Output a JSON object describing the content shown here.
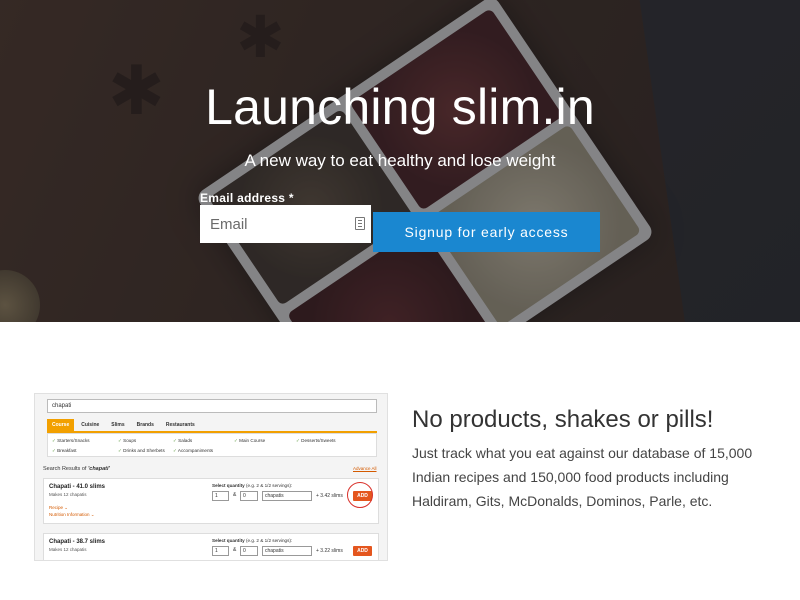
{
  "hero": {
    "title": "Launching slim.in",
    "subtitle": "A new way to eat healthy and lose weight",
    "email_label": "Email address *",
    "email_placeholder": "Email",
    "signup_label": "Signup for early access"
  },
  "feature": {
    "title": "No products, shakes or pills!",
    "body": "Just track what you eat against our database of 15,000 Indian recipes and 150,000 food products including Haldiram, Gits, McDonalds, Dominos, Parle, etc."
  },
  "preview": {
    "search_value": "chapati",
    "tabs": [
      "Course",
      "Cuisine",
      "Slims",
      "Brands",
      "Restaurants"
    ],
    "filters": [
      "Starters/Snacks",
      "Soups",
      "Salads",
      "Main Course",
      "Desserts/Sweets",
      "Breakfast",
      "Drinks and Sherbets",
      "Accompaniments"
    ],
    "results_prefix": "Search Results of",
    "results_query": "'chapati'",
    "right_link": "Advance All",
    "items": [
      {
        "name": "Chapati - 41.0 slims",
        "sub": "Makes 12 chapatis",
        "recipe": "Recipe ⌄",
        "nutrition": "Nutrition Information ⌄",
        "qty_label_bold": "Select quantity",
        "qty_label_rest": "(e.g. 2 & 1/2 servings):",
        "qty": "1",
        "amp": "&",
        "frac": "0",
        "unit": "chapatis",
        "slims": "+ 3.42 slims",
        "add": "ADD"
      },
      {
        "name": "Chapati - 38.7 slims",
        "sub": "Makes 12 chapatis",
        "qty_label_bold": "Select quantity",
        "qty_label_rest": "(e.g. 2 & 1/2 servings):",
        "qty": "1",
        "amp": "&",
        "frac": "0",
        "unit": "chapatis",
        "slims": "+ 3.22 slims",
        "add": "ADD"
      }
    ]
  },
  "colors": {
    "accent_button": "#1a87d0",
    "tab_orange": "#f2a000",
    "add_button": "#e4561e"
  }
}
